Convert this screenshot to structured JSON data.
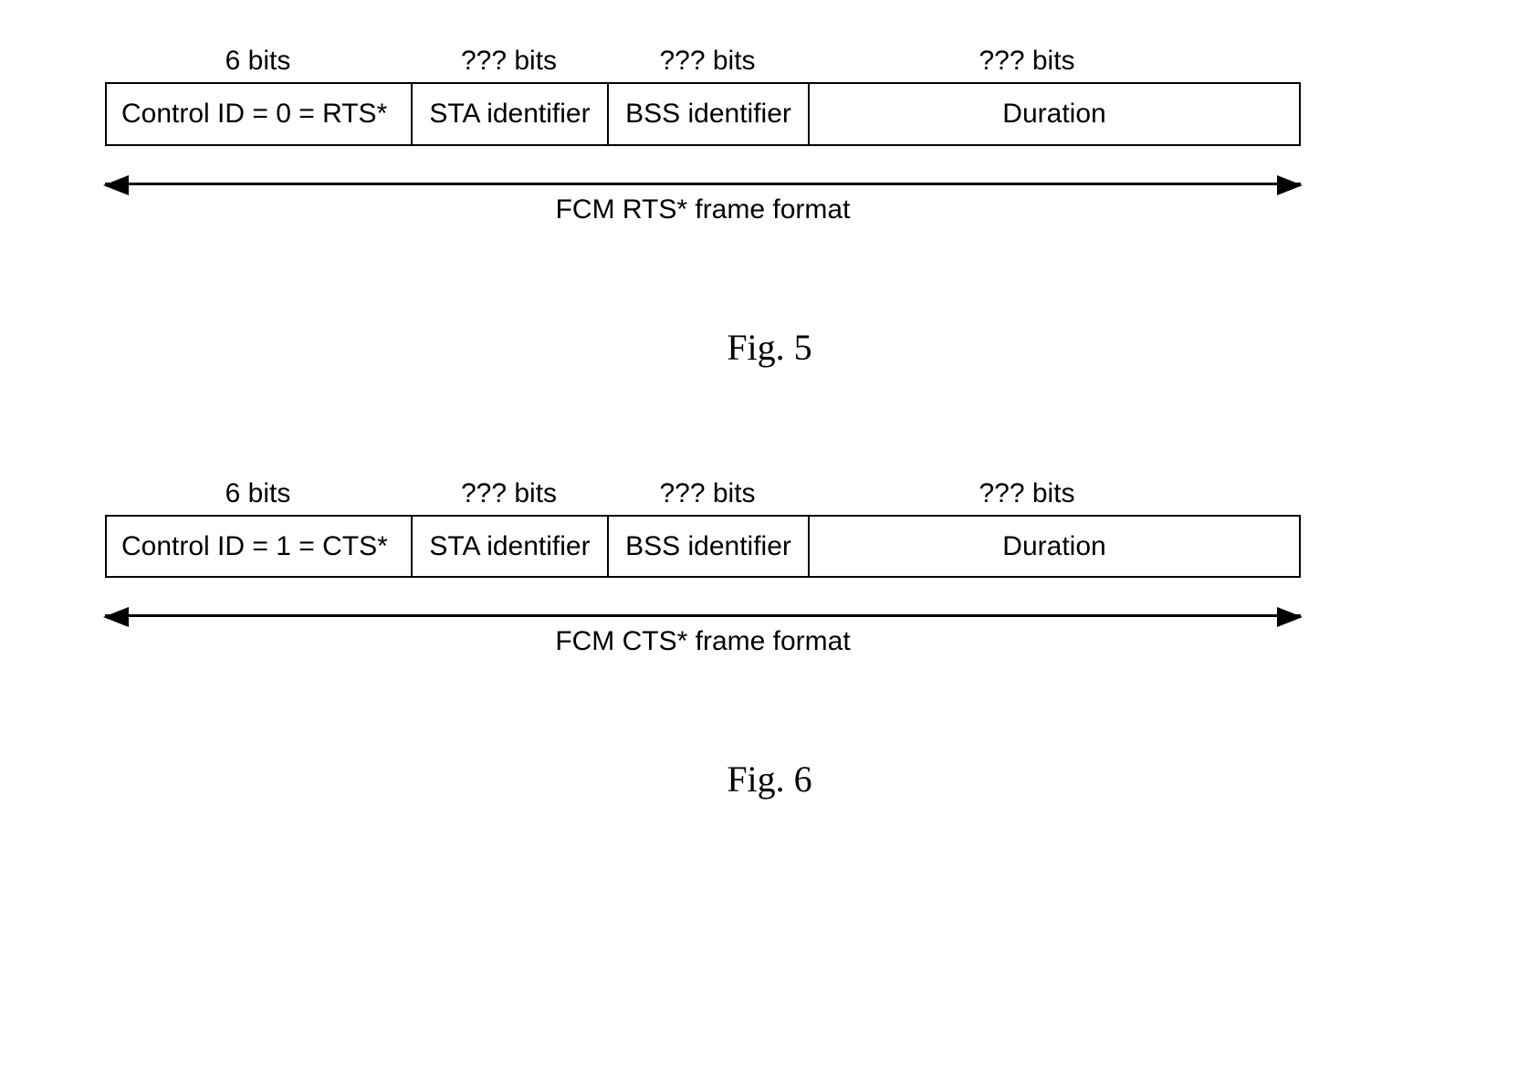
{
  "figures": [
    {
      "bits": [
        "6 bits",
        "??? bits",
        "??? bits",
        "??? bits"
      ],
      "cells": [
        "Control ID = 0 = RTS*",
        "STA identifier",
        "BSS identifier",
        "Duration"
      ],
      "arrow_label": "FCM RTS* frame format",
      "caption": "Fig. 5"
    },
    {
      "bits": [
        "6 bits",
        "??? bits",
        "??? bits",
        "??? bits"
      ],
      "cells": [
        "Control ID = 1 = CTS*",
        "STA identifier",
        "BSS identifier",
        "Duration"
      ],
      "arrow_label": "FCM CTS* frame format",
      "caption": "Fig. 6"
    }
  ]
}
